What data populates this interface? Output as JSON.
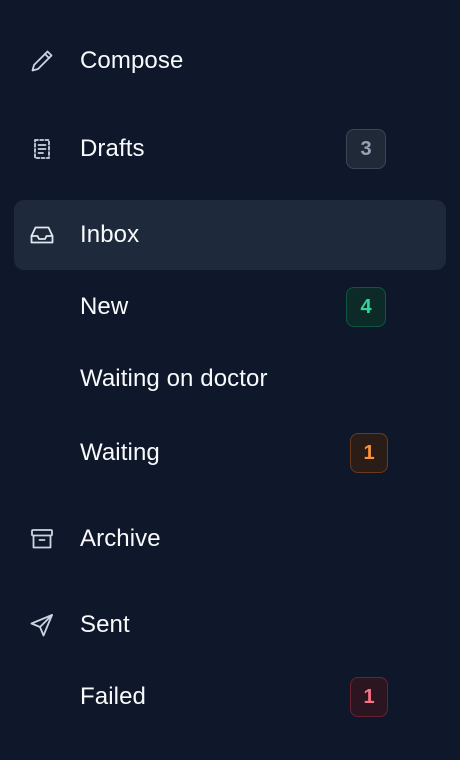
{
  "nav": {
    "items": [
      {
        "label": "Compose",
        "icon": "pencil-icon"
      },
      {
        "label": "Drafts",
        "icon": "drafts-icon",
        "badge": "3",
        "badge_color": "#94a3b8"
      },
      {
        "label": "Inbox",
        "icon": "inbox-icon",
        "active": true
      },
      {
        "label": "New",
        "badge": "4",
        "badge_color": "#34d399"
      },
      {
        "label": "Waiting on doctor"
      },
      {
        "label": "Waiting",
        "badge": "1",
        "badge_color": "#fb923c"
      },
      {
        "label": "Archive",
        "icon": "archive-icon"
      },
      {
        "label": "Sent",
        "icon": "send-icon"
      },
      {
        "label": "Failed",
        "badge": "1",
        "badge_color": "#fb7185"
      }
    ]
  },
  "colors": {
    "background": "#0f172a",
    "active_background": "#1e293b",
    "text": "#f8fafc",
    "icon": "#cbd5e1"
  }
}
